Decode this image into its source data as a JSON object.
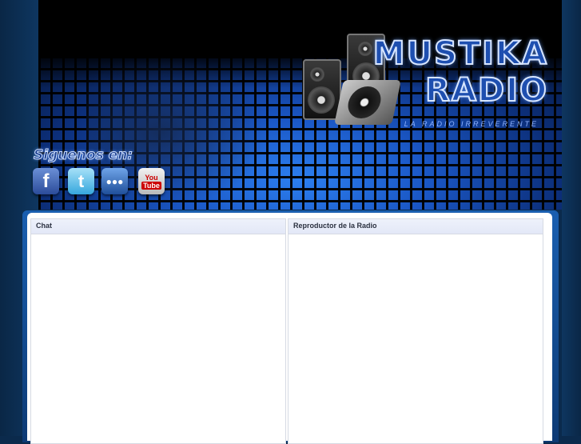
{
  "banner": {
    "logo_line1": "MUSTIKA",
    "logo_line2": "RADIO",
    "logo_tagline": "LA RADIO IRREVERENTE",
    "follow_label": "Siguenos en:"
  },
  "social": [
    {
      "name": "facebook",
      "glyph": "f"
    },
    {
      "name": "twitter",
      "glyph": "t"
    },
    {
      "name": "myspace",
      "glyph": "●●●"
    },
    {
      "name": "youtube",
      "glyph_top": "You",
      "glyph_bottom": "Tube"
    }
  ],
  "panels": {
    "chat_title": "Chat",
    "radio_title": "Reproductor de la Radio"
  },
  "colors": {
    "accent_blue": "#1a5fb0",
    "page_bg": "#0b2a4c"
  }
}
